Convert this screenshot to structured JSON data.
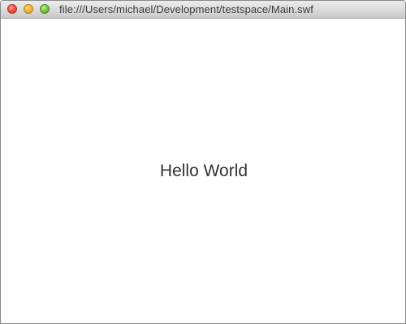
{
  "window": {
    "title": "file:///Users/michael/Development/testspace/Main.swf",
    "controls": {
      "close_icon": "close-traffic-light",
      "minimize_icon": "minimize-traffic-light",
      "zoom_icon": "zoom-traffic-light"
    }
  },
  "content": {
    "text": "Hello World"
  },
  "colors": {
    "close": "#f0534a",
    "minimize": "#f5b53b",
    "zoom": "#7dc944",
    "background": "#ffffff",
    "text": "#333333"
  }
}
